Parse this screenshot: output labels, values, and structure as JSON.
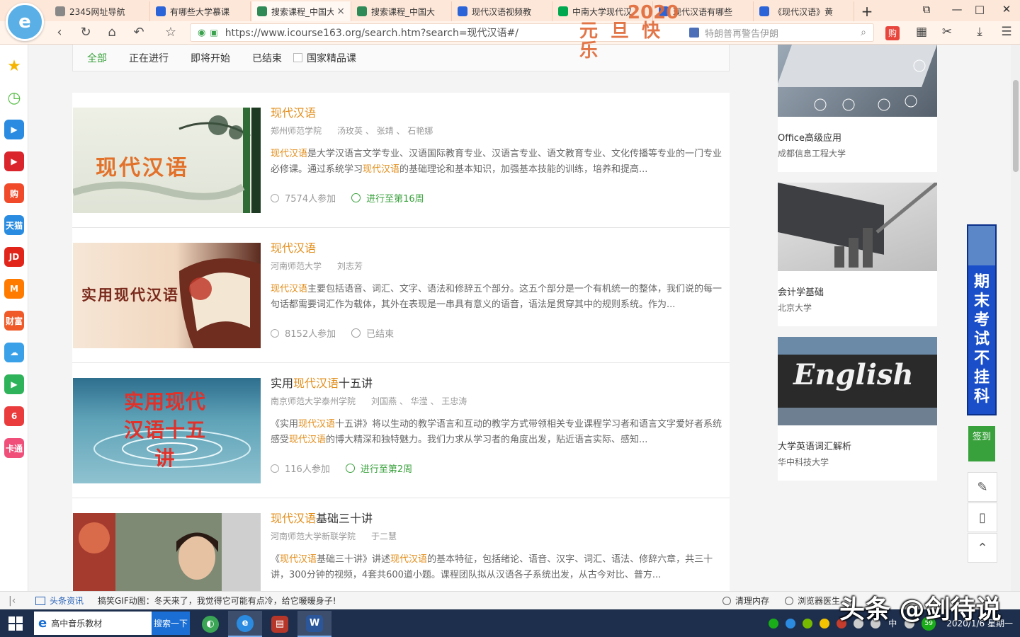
{
  "tabs": [
    {
      "label": "2345网址导航",
      "icon": "document-icon",
      "color": "#888888"
    },
    {
      "label": "有哪些大学慕课",
      "icon": "paw-icon",
      "color": "#2a64d8"
    },
    {
      "label": "搜索课程_中国大",
      "icon": "flag-icon",
      "color": "#2e8b57",
      "active": true
    },
    {
      "label": "搜索课程_中国大",
      "icon": "flag-icon",
      "color": "#2e8b57"
    },
    {
      "label": "现代汉语视频教",
      "icon": "paw-icon",
      "color": "#2a64d8"
    },
    {
      "label": "中南大学现代汉",
      "icon": "iqiyi-icon",
      "color": "#00a94f"
    },
    {
      "label": "现代汉语有哪些",
      "icon": "paw-icon",
      "color": "#2a64d8"
    },
    {
      "label": "《现代汉语》黄",
      "icon": "paw-icon",
      "color": "#2a64d8"
    }
  ],
  "tab_close": "×",
  "new_tab": "+",
  "logo_letter": "e",
  "promo": {
    "year": "2020",
    "text": "元旦快乐"
  },
  "window_controls": {
    "restore": "⧉",
    "minimize": "—",
    "maximize": "□",
    "close": "✕"
  },
  "address": {
    "url": "https://www.icourse163.org/search.htm?search=现代汉语#/",
    "hint": "特朗普再警告伊朗",
    "gou": "购"
  },
  "sidebar_icons": [
    {
      "name": "favorites-star-icon",
      "color": "#f5b400",
      "glyph": "★"
    },
    {
      "name": "history-clock-icon",
      "color": "#5bbf4a",
      "glyph": "◷"
    },
    {
      "name": "video-play-icon",
      "color": "#2b8be0",
      "glyph": "▶"
    },
    {
      "name": "youku-icon",
      "color": "#d9252b",
      "glyph": "▶"
    },
    {
      "name": "shopping-icon",
      "color": "#f04a2a",
      "glyph": "购"
    },
    {
      "name": "tmall-icon",
      "color": "#2a8ce0",
      "glyph": "天猫"
    },
    {
      "name": "jd-icon",
      "color": "#e1251b",
      "glyph": "JD"
    },
    {
      "name": "mgtv-icon",
      "color": "#ff7b00",
      "glyph": "M"
    },
    {
      "name": "finance-icon",
      "color": "#f05a28",
      "glyph": "财富"
    },
    {
      "name": "weather-icon",
      "color": "#3aa0e8",
      "glyph": "☁"
    },
    {
      "name": "tencent-video-icon",
      "color": "#2fb35a",
      "glyph": "▶"
    },
    {
      "name": "six-rooms-icon",
      "color": "#ea3c3c",
      "glyph": "6"
    },
    {
      "name": "card-icon",
      "color": "#f04f7a",
      "glyph": "卡通"
    }
  ],
  "filters": {
    "tabs": [
      "全部",
      "正在进行",
      "即将开始",
      "已结束"
    ],
    "checkbox": "国家精品课"
  },
  "courses": [
    {
      "title_pre": "",
      "title_hl": "现代汉语",
      "title_post": "",
      "thumb_text": "现代汉语",
      "meta": [
        "郑州师范学院",
        "汤玫英 、 张靖 、 石艳娜"
      ],
      "desc_hl": "现代汉语",
      "desc": "是大学汉语言文学专业、汉语国际教育专业、汉语言专业、语文教育专业、文化传播等专业的一门专业必修课。通过系统学习",
      "desc_hl2": "现代汉语",
      "desc2": "的基础理论和基本知识，加强基本技能的训练，培养和提高...",
      "participants": "7574人参加",
      "status": "进行至第16周",
      "live": true
    },
    {
      "title_pre": "",
      "title_hl": "现代汉语",
      "title_post": "",
      "thumb_text": "实用现代汉语",
      "meta": [
        "河南师范大学",
        "刘志芳"
      ],
      "desc_hl": "现代汉语",
      "desc": "主要包括语音、词汇、文字、语法和修辞五个部分。这五个部分是一个有机统一的整体，我们说的每一句话都需要词汇作为载体，其外在表现是一串具有意义的语音，语法是贯穿其中的规则系统。作为...",
      "desc_hl2": "",
      "desc2": "",
      "participants": "8152人参加",
      "status": "已结束",
      "live": false
    },
    {
      "title_pre": "实用",
      "title_hl": "现代汉语",
      "title_post": "十五讲",
      "thumb_text": "实用现代汉语十五讲",
      "meta": [
        "南京师范大学泰州学院",
        "刘国燕 、 华滢 、 王忠涛"
      ],
      "desc_pre": "《实用",
      "desc_hl": "现代汉语",
      "desc": "十五讲》将以生动的教学语言和互动的教学方式带领相关专业课程学习者和语言文字爱好者系统感受",
      "desc_hl2": "现代汉语",
      "desc2": "的博大精深和独特魅力。我们力求从学习者的角度出发，贴近语言实际、感知...",
      "participants": "116人参加",
      "status": "进行至第2周",
      "live": true
    },
    {
      "title_pre": "",
      "title_hl": "现代汉语",
      "title_post": "基础三十讲",
      "thumb_text": "",
      "meta": [
        "河南师范大学新联学院",
        "于二慧"
      ],
      "desc_pre": "《",
      "desc_hl": "现代汉语",
      "desc": "基础三十讲》讲述",
      "desc_hl2": "现代汉语",
      "desc2": "的基本特征，包括绪论、语音、汉字、词汇、语法、修辞六章，共三十讲，300分钟的视频，4套共600道小题。课程团队拟从汉语各子系统出发，从古今对比、普方...",
      "participants": "",
      "status": "",
      "live": false
    }
  ],
  "recommend": [
    {
      "title": "Office高级应用",
      "school": "成都信息工程大学"
    },
    {
      "title": "会计学基础",
      "school": "北京大学"
    },
    {
      "title": "大学英语词汇解析",
      "school": "华中科技大学"
    }
  ],
  "english_word": "English",
  "exam_banner": "期末考试不挂科",
  "checkin": "签到",
  "float_icons": [
    "✎",
    "▯",
    "⌃"
  ],
  "statusbar": {
    "news_label": "头条资讯",
    "news_text": "搞笑GIF动图：冬天来了，我觉得它可能有点冷，给它暖暖身子!",
    "clean": "清理内存",
    "doctor": "浏览器医生"
  },
  "watermark": "头条 @剑待说",
  "taskbar": {
    "search_value": "高中音乐教材",
    "search_button": "搜索一下",
    "ime": "中",
    "date": "2020/1/6 星期一",
    "badge": "59"
  }
}
